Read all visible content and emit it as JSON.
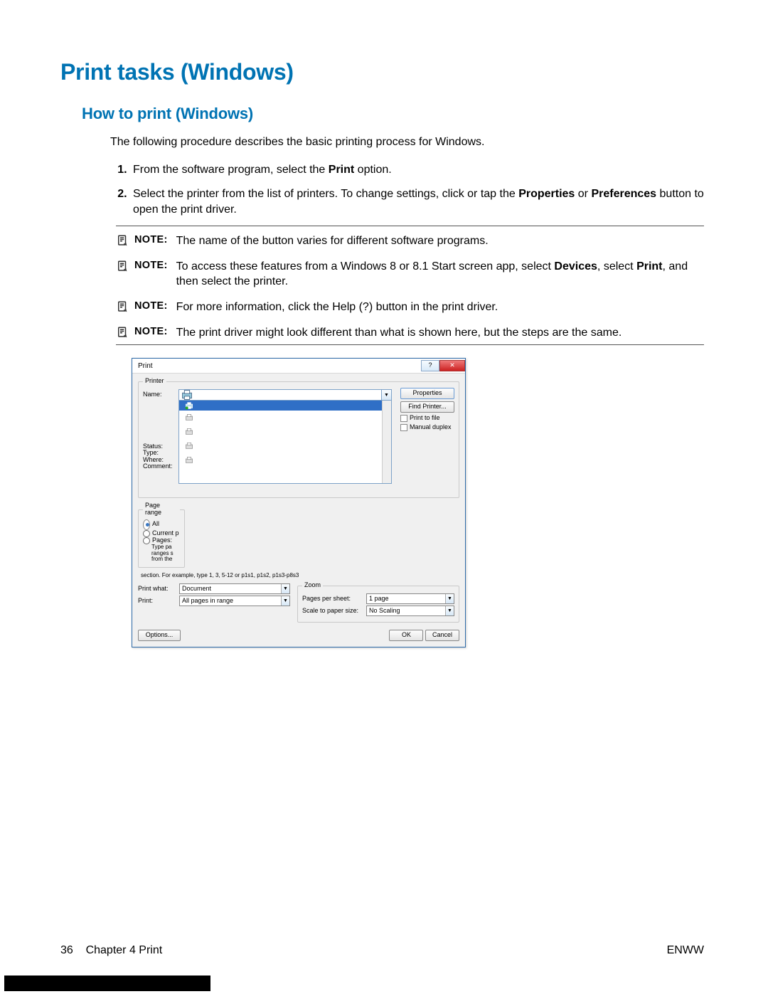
{
  "h1": "Print tasks (Windows)",
  "h2": "How to print (Windows)",
  "intro": "The following procedure describes the basic printing process for Windows.",
  "steps": {
    "s1_a": "From the software program, select the ",
    "s1_b": "Print",
    "s1_c": " option.",
    "s2_a": "Select the printer from the list of printers. To change settings, click or tap the ",
    "s2_b": "Properties",
    "s2_c": " or ",
    "s2_d": "Preferences",
    "s2_e": " button to open the print driver."
  },
  "notes": {
    "label": "NOTE:",
    "n1": "The name of the button varies for different software programs.",
    "n2_a": "To access these features from a Windows 8 or 8.1 Start screen app, select ",
    "n2_b": "Devices",
    "n2_c": ", select ",
    "n2_d": "Print",
    "n2_e": ", and then select the printer.",
    "n3": "For more information, click the Help (?) button in the print driver.",
    "n4": "The print driver might look different than what is shown here, but the steps are the same."
  },
  "dialog": {
    "title": "Print",
    "printer_legend": "Printer",
    "name": "Name:",
    "status": "Status:",
    "type": "Type:",
    "where": "Where:",
    "comment": "Comment:",
    "properties": "Properties",
    "find_printer": "Find Printer...",
    "print_to_file": "Print to file",
    "manual_duplex": "Manual duplex",
    "page_range_legend": "Page range",
    "all": "All",
    "current": "Current p",
    "pages": "Pages:",
    "type_pa": "Type pa",
    "ranges_s": "ranges s",
    "from_the": "from the",
    "section_hint": "section. For example, type 1, 3, 5-12 or p1s1, p1s2, p1s3-p8s3",
    "print_what": "Print what:",
    "document": "Document",
    "print_lbl": "Print:",
    "all_pages": "All pages in range",
    "zoom_legend": "Zoom",
    "pages_per_sheet": "Pages per sheet:",
    "one_page": "1 page",
    "scale": "Scale to paper size:",
    "no_scaling": "No Scaling",
    "options": "Options...",
    "ok": "OK",
    "cancel": "Cancel"
  },
  "footer": {
    "page": "36",
    "chapter": "Chapter 4   Print",
    "right": "ENWW"
  }
}
